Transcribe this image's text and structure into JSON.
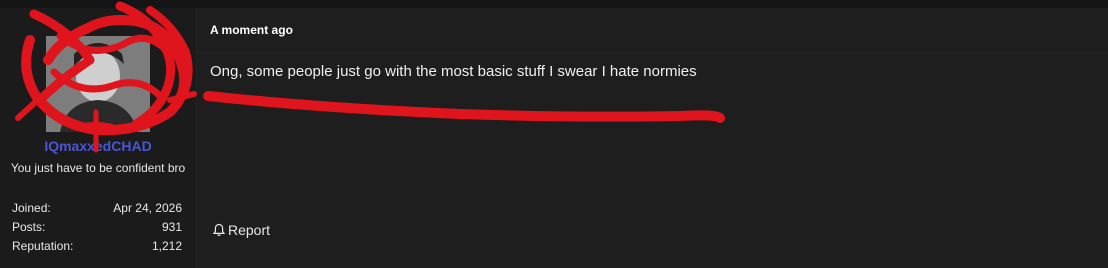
{
  "post": {
    "timestamp": "A moment ago",
    "message": "Ong, some people just go with the most basic stuff I swear I hate normies",
    "report_label": "Report"
  },
  "user": {
    "username": "IQmaxxedCHAD",
    "title": "You just have to be confident bro",
    "stats": [
      {
        "label": "Joined:",
        "value": "Apr 24, 2026"
      },
      {
        "label": "Posts:",
        "value": "931"
      },
      {
        "label": "Reputation:",
        "value": "1,212"
      }
    ]
  },
  "colors": {
    "username": "#4a56d6",
    "scribble": "#e0141c",
    "background": "#1e1e1e"
  },
  "icons": {
    "report": "bell-icon"
  }
}
